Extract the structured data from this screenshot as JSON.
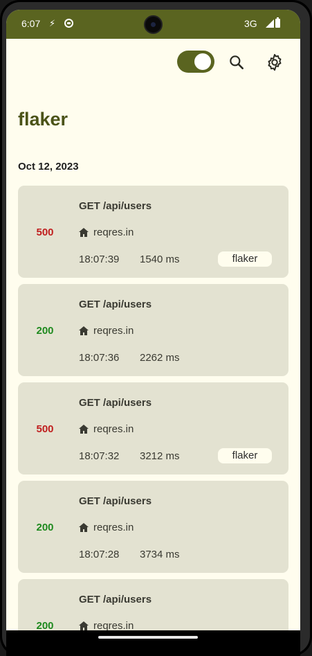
{
  "status_bar": {
    "time": "6:07",
    "network": "3G",
    "icons": [
      "nfc-icon",
      "sync-icon",
      "signal-icon",
      "battery-icon"
    ]
  },
  "toolbar": {
    "toggle_on": true,
    "icons": [
      "search-icon",
      "settings-icon"
    ]
  },
  "app": {
    "title": "flaker",
    "accent_color": "#5a6420",
    "background": "#fffdee"
  },
  "section": {
    "date": "Oct 12, 2023"
  },
  "requests": [
    {
      "code": "500",
      "method_path": "GET /api/users",
      "host": "reqres.in",
      "time": "18:07:39",
      "duration": "1540 ms",
      "tag": "flaker"
    },
    {
      "code": "200",
      "method_path": "GET /api/users",
      "host": "reqres.in",
      "time": "18:07:36",
      "duration": "2262 ms",
      "tag": ""
    },
    {
      "code": "500",
      "method_path": "GET /api/users",
      "host": "reqres.in",
      "time": "18:07:32",
      "duration": "3212 ms",
      "tag": "flaker"
    },
    {
      "code": "200",
      "method_path": "GET /api/users",
      "host": "reqres.in",
      "time": "18:07:28",
      "duration": "3734 ms",
      "tag": ""
    },
    {
      "code": "200",
      "method_path": "GET /api/users",
      "host": "reqres.in",
      "time": "",
      "duration": "",
      "tag": ""
    }
  ]
}
